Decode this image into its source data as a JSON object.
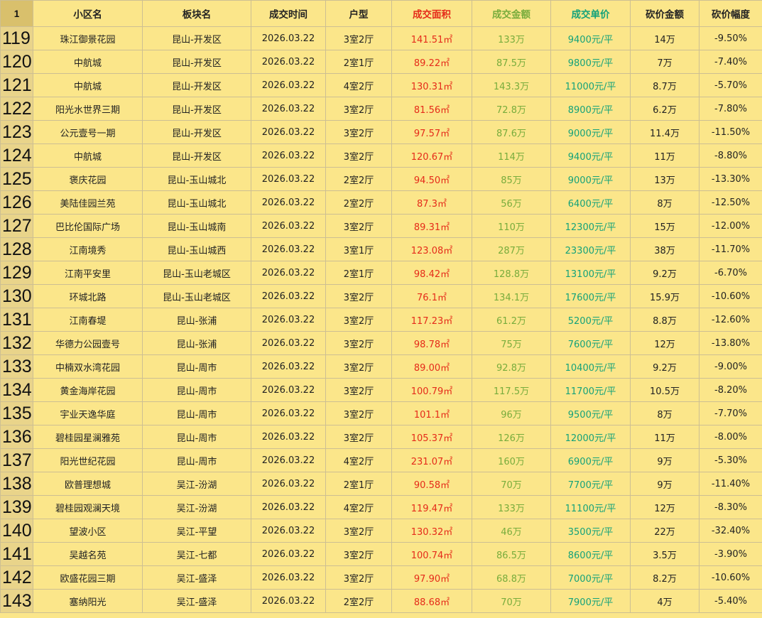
{
  "colors": {
    "area": "#e52b1a",
    "amount": "#78ac3c",
    "unit_price": "#14a27a",
    "background": "#fbe68a"
  },
  "header": {
    "row_num": "1",
    "cols": [
      "小区名",
      "板块名",
      "成交时间",
      "户型",
      "成交面积",
      "成交金额",
      "成交单价",
      "砍价金额",
      "砍价幅度"
    ]
  },
  "rows": [
    {
      "n": "119",
      "name": "珠江御景花园",
      "district": "昆山-开发区",
      "date": "2026.03.22",
      "layout": "3室2厅",
      "area": "141.51㎡",
      "amount": "133万",
      "unit": "9400元/平",
      "cut": "14万",
      "pct": "-9.50%"
    },
    {
      "n": "120",
      "name": "中航城",
      "district": "昆山-开发区",
      "date": "2026.03.22",
      "layout": "2室1厅",
      "area": "89.22㎡",
      "amount": "87.5万",
      "unit": "9800元/平",
      "cut": "7万",
      "pct": "-7.40%"
    },
    {
      "n": "121",
      "name": "中航城",
      "district": "昆山-开发区",
      "date": "2026.03.22",
      "layout": "4室2厅",
      "area": "130.31㎡",
      "amount": "143.3万",
      "unit": "11000元/平",
      "cut": "8.7万",
      "pct": "-5.70%"
    },
    {
      "n": "122",
      "name": "阳光水世界三期",
      "district": "昆山-开发区",
      "date": "2026.03.22",
      "layout": "3室2厅",
      "area": "81.56㎡",
      "amount": "72.8万",
      "unit": "8900元/平",
      "cut": "6.2万",
      "pct": "-7.80%"
    },
    {
      "n": "123",
      "name": "公元壹号一期",
      "district": "昆山-开发区",
      "date": "2026.03.22",
      "layout": "3室2厅",
      "area": "97.57㎡",
      "amount": "87.6万",
      "unit": "9000元/平",
      "cut": "11.4万",
      "pct": "-11.50%"
    },
    {
      "n": "124",
      "name": "中航城",
      "district": "昆山-开发区",
      "date": "2026.03.22",
      "layout": "3室2厅",
      "area": "120.67㎡",
      "amount": "114万",
      "unit": "9400元/平",
      "cut": "11万",
      "pct": "-8.80%"
    },
    {
      "n": "125",
      "name": "褒庆花园",
      "district": "昆山-玉山城北",
      "date": "2026.03.22",
      "layout": "2室2厅",
      "area": "94.50㎡",
      "amount": "85万",
      "unit": "9000元/平",
      "cut": "13万",
      "pct": "-13.30%"
    },
    {
      "n": "126",
      "name": "美陆佳园兰苑",
      "district": "昆山-玉山城北",
      "date": "2026.03.22",
      "layout": "2室2厅",
      "area": "87.3㎡",
      "amount": "56万",
      "unit": "6400元/平",
      "cut": "8万",
      "pct": "-12.50%"
    },
    {
      "n": "127",
      "name": "巴比伦国际广场",
      "district": "昆山-玉山城南",
      "date": "2026.03.22",
      "layout": "3室2厅",
      "area": "89.31㎡",
      "amount": "110万",
      "unit": "12300元/平",
      "cut": "15万",
      "pct": "-12.00%"
    },
    {
      "n": "128",
      "name": "江南境秀",
      "district": "昆山-玉山城西",
      "date": "2026.03.22",
      "layout": "3室1厅",
      "area": "123.08㎡",
      "amount": "287万",
      "unit": "23300元/平",
      "cut": "38万",
      "pct": "-11.70%"
    },
    {
      "n": "129",
      "name": "江南平安里",
      "district": "昆山-玉山老城区",
      "date": "2026.03.22",
      "layout": "2室1厅",
      "area": "98.42㎡",
      "amount": "128.8万",
      "unit": "13100元/平",
      "cut": "9.2万",
      "pct": "-6.70%"
    },
    {
      "n": "130",
      "name": "环城北路",
      "district": "昆山-玉山老城区",
      "date": "2026.03.22",
      "layout": "3室2厅",
      "area": "76.1㎡",
      "amount": "134.1万",
      "unit": "17600元/平",
      "cut": "15.9万",
      "pct": "-10.60%"
    },
    {
      "n": "131",
      "name": "江南春堤",
      "district": "昆山-张浦",
      "date": "2026.03.22",
      "layout": "3室2厅",
      "area": "117.23㎡",
      "amount": "61.2万",
      "unit": "5200元/平",
      "cut": "8.8万",
      "pct": "-12.60%"
    },
    {
      "n": "132",
      "name": "华德力公园壹号",
      "district": "昆山-张浦",
      "date": "2026.03.22",
      "layout": "3室2厅",
      "area": "98.78㎡",
      "amount": "75万",
      "unit": "7600元/平",
      "cut": "12万",
      "pct": "-13.80%"
    },
    {
      "n": "133",
      "name": "中楠双水湾花园",
      "district": "昆山-周市",
      "date": "2026.03.22",
      "layout": "3室2厅",
      "area": "89.00㎡",
      "amount": "92.8万",
      "unit": "10400元/平",
      "cut": "9.2万",
      "pct": "-9.00%"
    },
    {
      "n": "134",
      "name": "黄金海岸花园",
      "district": "昆山-周市",
      "date": "2026.03.22",
      "layout": "3室2厅",
      "area": "100.79㎡",
      "amount": "117.5万",
      "unit": "11700元/平",
      "cut": "10.5万",
      "pct": "-8.20%"
    },
    {
      "n": "135",
      "name": "宇业天逸华庭",
      "district": "昆山-周市",
      "date": "2026.03.22",
      "layout": "3室2厅",
      "area": "101.1㎡",
      "amount": "96万",
      "unit": "9500元/平",
      "cut": "8万",
      "pct": "-7.70%"
    },
    {
      "n": "136",
      "name": "碧桂园星澜雅苑",
      "district": "昆山-周市",
      "date": "2026.03.22",
      "layout": "3室2厅",
      "area": "105.37㎡",
      "amount": "126万",
      "unit": "12000元/平",
      "cut": "11万",
      "pct": "-8.00%"
    },
    {
      "n": "137",
      "name": "阳光世纪花园",
      "district": "昆山-周市",
      "date": "2026.03.22",
      "layout": "4室2厅",
      "area": "231.07㎡",
      "amount": "160万",
      "unit": "6900元/平",
      "cut": "9万",
      "pct": "-5.30%"
    },
    {
      "n": "138",
      "name": "欧普理想城",
      "district": "吴江-汾湖",
      "date": "2026.03.22",
      "layout": "2室1厅",
      "area": "90.58㎡",
      "amount": "70万",
      "unit": "7700元/平",
      "cut": "9万",
      "pct": "-11.40%"
    },
    {
      "n": "139",
      "name": "碧桂园观澜天境",
      "district": "吴江-汾湖",
      "date": "2026.03.22",
      "layout": "4室2厅",
      "area": "119.47㎡",
      "amount": "133万",
      "unit": "11100元/平",
      "cut": "12万",
      "pct": "-8.30%"
    },
    {
      "n": "140",
      "name": "望波小区",
      "district": "吴江-平望",
      "date": "2026.03.22",
      "layout": "3室2厅",
      "area": "130.32㎡",
      "amount": "46万",
      "unit": "3500元/平",
      "cut": "22万",
      "pct": "-32.40%"
    },
    {
      "n": "141",
      "name": "吴越名苑",
      "district": "吴江-七都",
      "date": "2026.03.22",
      "layout": "3室2厅",
      "area": "100.74㎡",
      "amount": "86.5万",
      "unit": "8600元/平",
      "cut": "3.5万",
      "pct": "-3.90%"
    },
    {
      "n": "142",
      "name": "欧盛花园三期",
      "district": "吴江-盛泽",
      "date": "2026.03.22",
      "layout": "3室2厅",
      "area": "97.90㎡",
      "amount": "68.8万",
      "unit": "7000元/平",
      "cut": "8.2万",
      "pct": "-10.60%"
    },
    {
      "n": "143",
      "name": "塞纳阳光",
      "district": "吴江-盛泽",
      "date": "2026.03.22",
      "layout": "2室2厅",
      "area": "88.68㎡",
      "amount": "70万",
      "unit": "7900元/平",
      "cut": "4万",
      "pct": "-5.40%"
    }
  ]
}
